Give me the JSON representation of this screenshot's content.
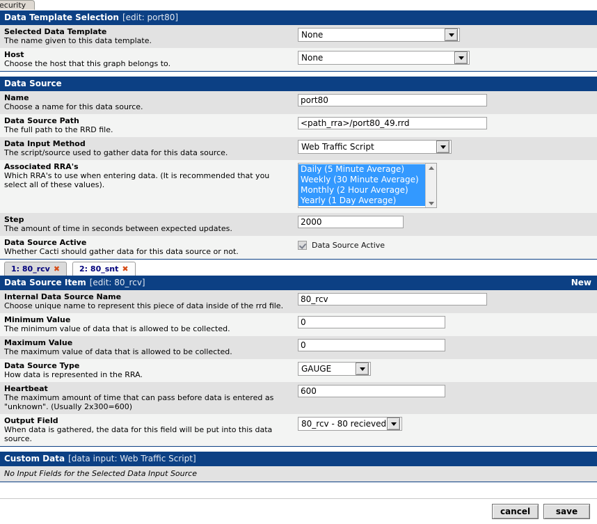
{
  "browser": {
    "tab_label": "ecurity"
  },
  "data_template_selection": {
    "title": "Data Template Selection",
    "suffix": "[edit: port80]",
    "rows": [
      {
        "label": "Selected Data Template",
        "desc": "The name given to this data template.",
        "value": "None"
      },
      {
        "label": "Host",
        "desc": "Choose the host that this graph belongs to.",
        "value": "None"
      }
    ]
  },
  "data_source": {
    "title": "Data Source",
    "suffix": "",
    "name": {
      "label": "Name",
      "desc": "Choose a name for this data source.",
      "value": "port80"
    },
    "path": {
      "label": "Data Source Path",
      "desc": "The full path to the RRD file.",
      "value": "<path_rra>/port80_49.rrd"
    },
    "input_method": {
      "label": "Data Input Method",
      "desc": "The script/source used to gather data for this data source.",
      "value": "Web Traffic Script"
    },
    "rras": {
      "label": "Associated RRA's",
      "desc": "Which RRA's to use when entering data. (It is recommended that you select all of these values).",
      "options": [
        "Daily (5 Minute Average)",
        "Weekly (30 Minute Average)",
        "Monthly (2 Hour Average)",
        "Yearly (1 Day Average)"
      ]
    },
    "step": {
      "label": "Step",
      "desc": "The amount of time in seconds between expected updates.",
      "value": "2000"
    },
    "active": {
      "label": "Data Source Active",
      "desc": "Whether Cacti should gather data for this data source or not.",
      "checkbox_label": "Data Source Active",
      "checked": true
    }
  },
  "tabs": [
    {
      "label": "1: 80_rcv",
      "close": "✖",
      "active": true
    },
    {
      "label": "2: 80_snt",
      "close": "✖",
      "active": false
    }
  ],
  "data_source_item": {
    "title": "Data Source Item",
    "suffix": "[edit: 80_rcv]",
    "new_label": "New",
    "internal_name": {
      "label": "Internal Data Source Name",
      "desc": "Choose unique name to represent this piece of data inside of the rrd file.",
      "value": "80_rcv"
    },
    "minimum": {
      "label": "Minimum Value",
      "desc": "The minimum value of data that is allowed to be collected.",
      "value": "0"
    },
    "maximum": {
      "label": "Maximum Value",
      "desc": "The maximum value of data that is allowed to be collected.",
      "value": "0"
    },
    "ds_type": {
      "label": "Data Source Type",
      "desc": "How data is represented in the RRA.",
      "value": "GAUGE"
    },
    "heartbeat": {
      "label": "Heartbeat",
      "desc": "The maximum amount of time that can pass before data is entered as \"unknown\". (Usually 2x300=600)",
      "value": "600"
    },
    "output_field": {
      "label": "Output Field",
      "desc": "When data is gathered, the data for this field will be put into this data source.",
      "value": "80_rcv - 80 recieved"
    }
  },
  "custom_data": {
    "title": "Custom Data",
    "suffix": "[data input: Web Traffic Script]",
    "note": "No Input Fields for the Selected Data Input Source"
  },
  "footer": {
    "cancel_label": "cancel",
    "save_label": "save"
  },
  "colors": {
    "header_bar": "#0c4084",
    "row_odd": "#e2e2e2",
    "row_even": "#f3f4f3",
    "selection": "#3399ff",
    "tab_text": "#00007c",
    "tab_close": "#d64b16"
  }
}
